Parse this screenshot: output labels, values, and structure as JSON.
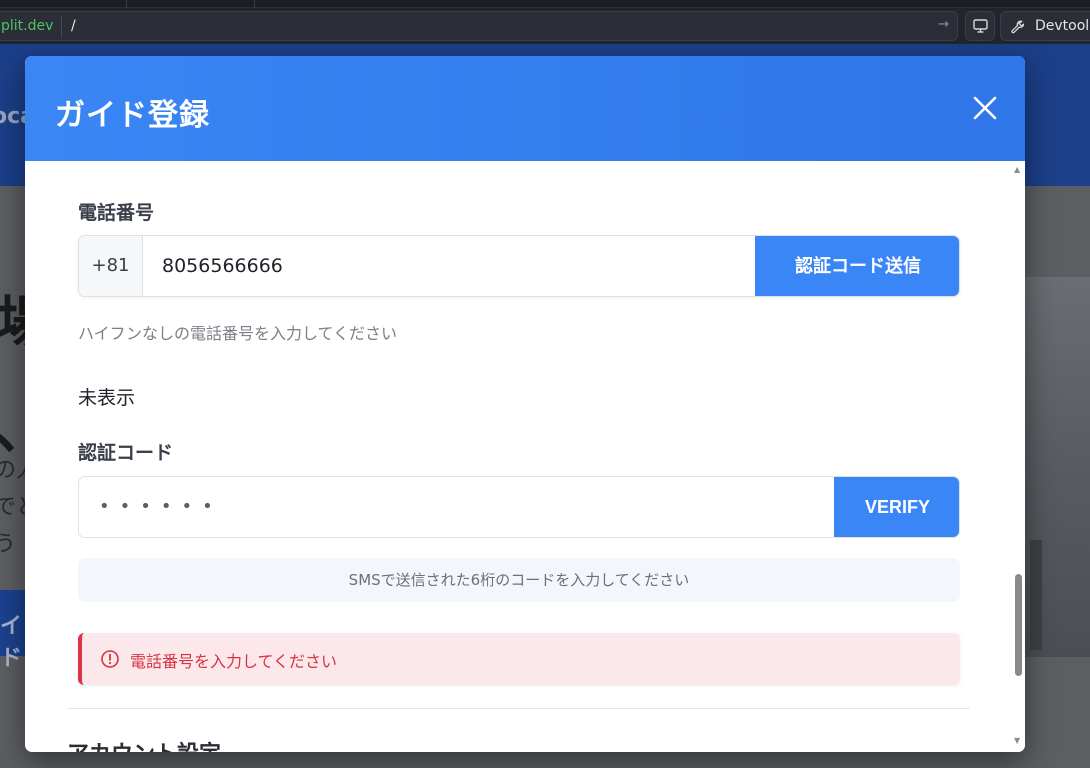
{
  "browser": {
    "url_host": "plit.dev",
    "url_path": "/",
    "devtools_label": "Devtools"
  },
  "background_page": {
    "brand_fragment": "oca",
    "heading_line1": "場",
    "heading_line2": "、",
    "text_line1": "の人",
    "text_line2": "でと",
    "text_line3": "う",
    "cta_fragment": "イド"
  },
  "modal": {
    "title": "ガイド登録",
    "phone": {
      "label": "電話番号",
      "country_code": "+81",
      "value": "8056566666",
      "send_button": "認証コード送信",
      "help": "ハイフンなしの電話番号を入力してください"
    },
    "status_text": "未表示",
    "verification": {
      "label": "認証コード",
      "masked_value": "••••••",
      "verify_button": "VERIFY",
      "hint": "SMSで送信された6桁のコードを入力してください"
    },
    "error": {
      "message": "電話番号を入力してください"
    },
    "next_section_title": "アカウント設定"
  },
  "colors": {
    "primary": "#3b86f6",
    "error": "#dc3545",
    "error_bg": "#fce8ea"
  }
}
